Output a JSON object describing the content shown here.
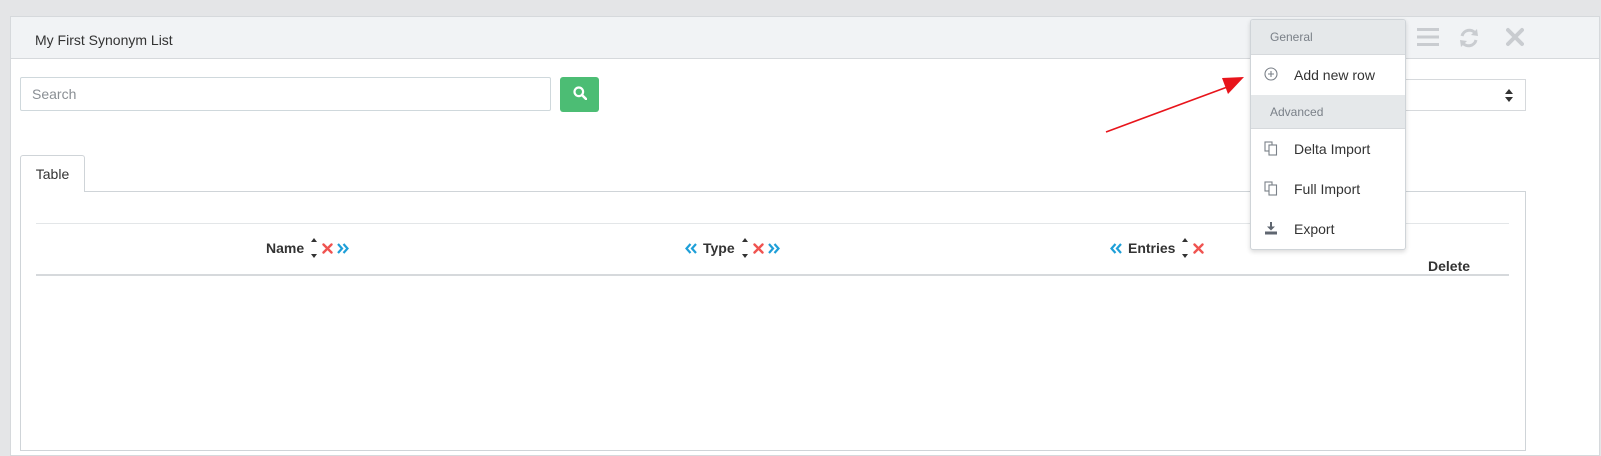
{
  "panel": {
    "title": "My First Synonym List"
  },
  "header_icons": [
    "menu-icon",
    "refresh-icon",
    "close-icon"
  ],
  "search": {
    "placeholder": "Search",
    "value": "",
    "button_icon": "search-icon"
  },
  "tabs": [
    {
      "label": "Table",
      "active": true
    }
  ],
  "table": {
    "columns": [
      {
        "label": "Name",
        "controls": [
          "sort",
          "remove",
          "move-right"
        ]
      },
      {
        "label": "Type",
        "controls": [
          "move-left",
          "sort",
          "remove",
          "move-right"
        ]
      },
      {
        "label": "Entries",
        "controls": [
          "move-left",
          "sort",
          "remove"
        ]
      },
      {
        "label": "Delete",
        "controls": []
      }
    ],
    "rows": []
  },
  "dropdown": {
    "sections": [
      {
        "label": "General",
        "items": [
          {
            "label": "Add new row",
            "icon": "plus-circle-icon"
          }
        ]
      },
      {
        "label": "Advanced",
        "items": [
          {
            "label": "Delta Import",
            "icon": "copy-icon"
          },
          {
            "label": "Full Import",
            "icon": "copy-icon"
          },
          {
            "label": "Export",
            "icon": "download-icon"
          }
        ]
      }
    ]
  },
  "colors": {
    "accent_green": "#4cbd74",
    "move_blue": "#1e9fd8",
    "remove_red": "#ef5350",
    "annotation_arrow": "#e8141b"
  }
}
